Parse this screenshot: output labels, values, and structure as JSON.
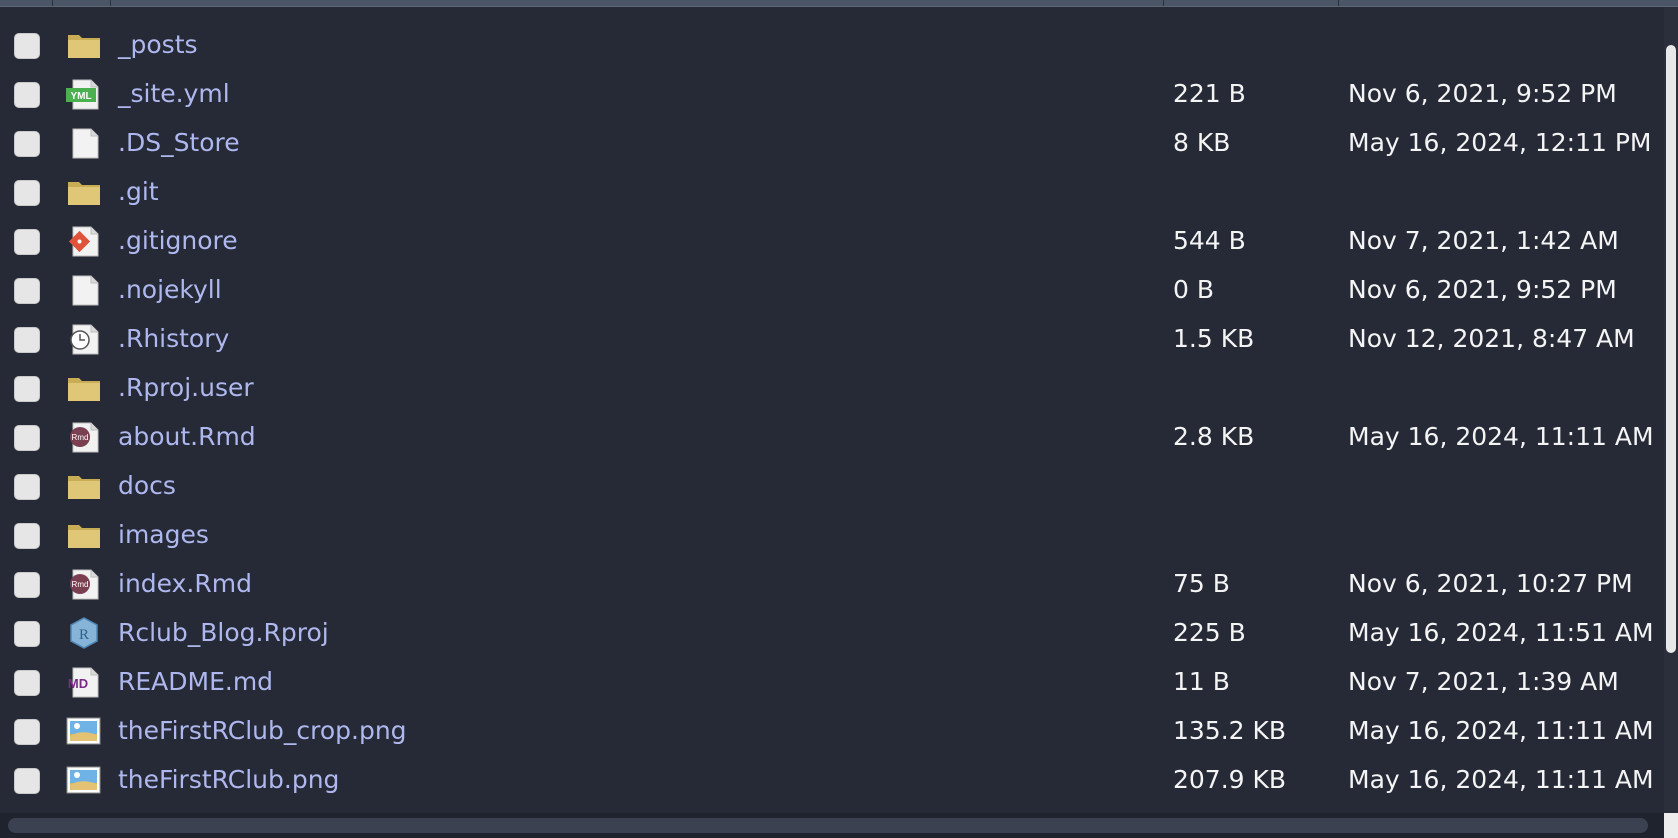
{
  "files": [
    {
      "name": "_posts",
      "size": "",
      "modified": "",
      "icon": "folder-icon"
    },
    {
      "name": "_site.yml",
      "size": "221 B",
      "modified": "Nov 6, 2021, 9:52 PM",
      "icon": "yaml-file-icon"
    },
    {
      "name": ".DS_Store",
      "size": "8 KB",
      "modified": "May 16, 2024, 12:11 PM",
      "icon": "blank-file-icon"
    },
    {
      "name": ".git",
      "size": "",
      "modified": "",
      "icon": "folder-icon"
    },
    {
      "name": ".gitignore",
      "size": "544 B",
      "modified": "Nov 7, 2021, 1:42 AM",
      "icon": "git-file-icon"
    },
    {
      "name": ".nojekyll",
      "size": "0 B",
      "modified": "Nov 6, 2021, 9:52 PM",
      "icon": "blank-file-icon"
    },
    {
      "name": ".Rhistory",
      "size": "1.5 KB",
      "modified": "Nov 12, 2021, 8:47 AM",
      "icon": "history-file-icon"
    },
    {
      "name": ".Rproj.user",
      "size": "",
      "modified": "",
      "icon": "folder-icon"
    },
    {
      "name": "about.Rmd",
      "size": "2.8 KB",
      "modified": "May 16, 2024, 11:11 AM",
      "icon": "rmd-file-icon"
    },
    {
      "name": "docs",
      "size": "",
      "modified": "",
      "icon": "folder-icon"
    },
    {
      "name": "images",
      "size": "",
      "modified": "",
      "icon": "folder-icon"
    },
    {
      "name": "index.Rmd",
      "size": "75 B",
      "modified": "Nov 6, 2021, 10:27 PM",
      "icon": "rmd-file-icon"
    },
    {
      "name": "Rclub_Blog.Rproj",
      "size": "225 B",
      "modified": "May 16, 2024, 11:51 AM",
      "icon": "rproj-file-icon"
    },
    {
      "name": "README.md",
      "size": "11 B",
      "modified": "Nov 7, 2021, 1:39 AM",
      "icon": "markdown-file-icon"
    },
    {
      "name": "theFirstRClub_crop.png",
      "size": "135.2 KB",
      "modified": "May 16, 2024, 11:11 AM",
      "icon": "image-file-icon"
    },
    {
      "name": "theFirstRClub.png",
      "size": "207.9 KB",
      "modified": "May 16, 2024, 11:11 AM",
      "icon": "image-file-icon"
    }
  ],
  "icon_labels": {
    "yaml": "YML",
    "rmd": "Rmd",
    "rproj": "R",
    "markdown": "MD"
  },
  "colors": {
    "background": "#262a37",
    "filename_link": "#aeb8ee",
    "metadata_text": "#f4f4f4",
    "folder": "#e0c777",
    "checkbox": "#e6e6e6"
  }
}
